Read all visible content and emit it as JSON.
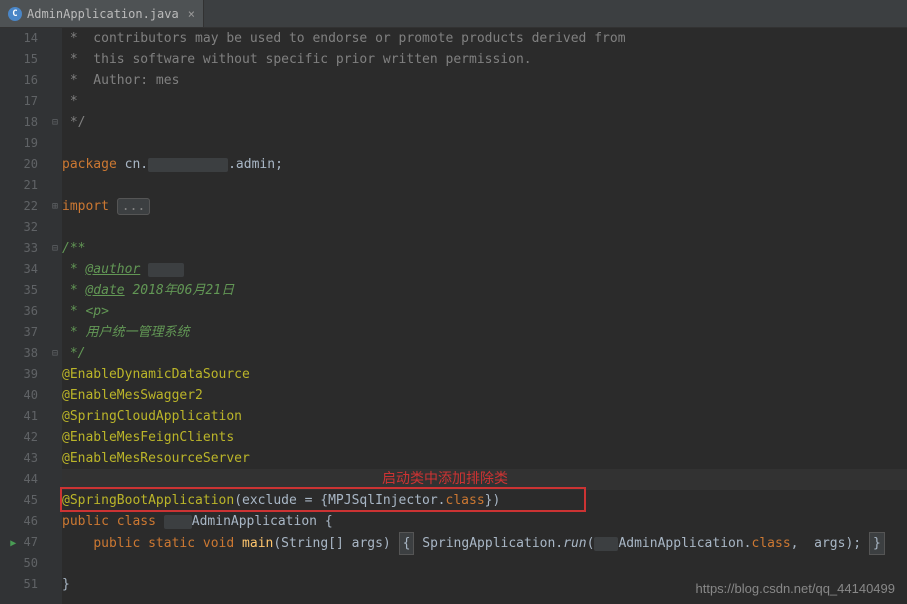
{
  "tab": {
    "icon_letter": "C",
    "filename": "AdminApplication.java",
    "close": "×"
  },
  "line_numbers": [
    "14",
    "15",
    "16",
    "17",
    "18",
    "19",
    "20",
    "21",
    "22",
    "32",
    "33",
    "34",
    "35",
    "36",
    "37",
    "38",
    "39",
    "40",
    "41",
    "42",
    "43",
    "44",
    "45",
    "46",
    "47",
    "50",
    "51"
  ],
  "code": {
    "l14": " *  contributors may be used to endorse or promote products derived from",
    "l15": " *  this software without specific prior written permission.",
    "l16": " *  Author: mes",
    "l17": " *",
    "l18": " */",
    "l20_package": "package",
    "l20_cn": " cn.",
    "l20_admin": ".admin;",
    "l22_import": "import",
    "l22_dots": "...",
    "l33_open": "/**",
    "l34_star": " * ",
    "l34_author": "@author",
    "l35_star": " * ",
    "l35_date": "@date",
    "l35_date_val": " 2018年06月21日",
    "l36": " * <p>",
    "l37": " * 用户统一管理系统",
    "l38": " */",
    "l39": "@EnableDynamicDataSource",
    "l40": "@EnableMesSwagger2",
    "l41": "@SpringCloudApplication",
    "l42": "@EnableMesFeignClients",
    "l43": "@EnableMesResourceServer",
    "l45_ann": "@SpringBootApplication",
    "l45_paren": "(exclude = {MPJSqlInjector.",
    "l45_class": "class",
    "l45_end": "})",
    "l46_public": "public",
    "l46_class": " class",
    "l46_name": "AdminApplication {",
    "l47_public": "public",
    "l47_static": " static",
    "l47_void": " void",
    "l47_main": " main",
    "l47_args": "(String[] args) ",
    "l47_spring": " SpringApplication.",
    "l47_run": "run",
    "l47_app": "AdminApplication.",
    "l47_class2": "class",
    "l47_end": ",  args); ",
    "l51": "}"
  },
  "annotation_text": "启动类中添加排除类",
  "watermark": "https://blog.csdn.net/qq_44140499"
}
